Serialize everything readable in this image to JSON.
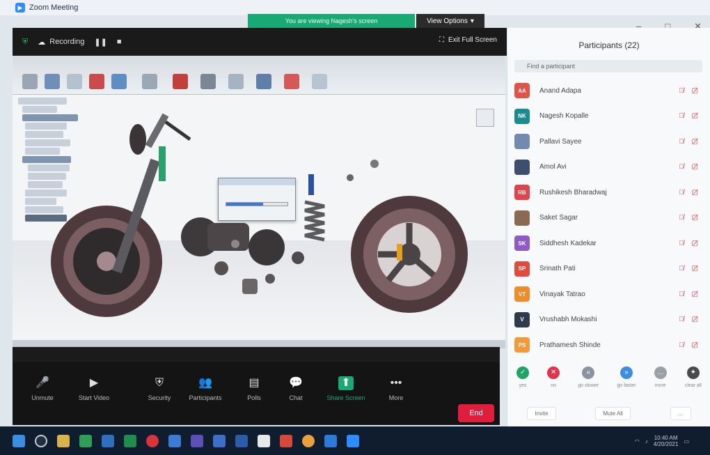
{
  "window": {
    "title": "Zoom Meeting"
  },
  "banner": {
    "text": "You are viewing Nagesh's screen",
    "view_options": "View Options"
  },
  "meeting_bar": {
    "recording": "Recording",
    "exit_full_screen": "Exit Full Screen"
  },
  "panel": {
    "title": "Participants (22)",
    "search_placeholder": "Find a participant",
    "participants": [
      {
        "initials": "AA",
        "name": "Anand Adapa",
        "color": "#e05346"
      },
      {
        "initials": "NK",
        "name": "Nagesh Kopalle",
        "color": "#1c8b8f"
      },
      {
        "initials": "",
        "name": "Pallavi Sayee",
        "color": "#7289b0"
      },
      {
        "initials": "",
        "name": "Amol Avi",
        "color": "#3c4f6d"
      },
      {
        "initials": "RB",
        "name": "Rushikesh Bharadwaj",
        "color": "#e0434a"
      },
      {
        "initials": "",
        "name": "Saket Sagar",
        "color": "#8a6a52"
      },
      {
        "initials": "SK",
        "name": "Siddhesh Kadekar",
        "color": "#8e5bc6"
      },
      {
        "initials": "SP",
        "name": "Srinath Pati",
        "color": "#e04b3e"
      },
      {
        "initials": "VT",
        "name": "Vinayak Tatrao",
        "color": "#ef8c2a"
      },
      {
        "initials": "V",
        "name": "Vrushabh Mokashi",
        "color": "#2f3a4c"
      },
      {
        "initials": "PS",
        "name": "Prathamesh Shinde",
        "color": "#f29a3a"
      }
    ],
    "reactions": [
      {
        "label": "yes",
        "color": "#1fa463",
        "glyph": "✓"
      },
      {
        "label": "no",
        "color": "#e2334a",
        "glyph": "✕"
      },
      {
        "label": "go slower",
        "color": "#8a94a0",
        "glyph": "«"
      },
      {
        "label": "go faster",
        "color": "#3a8ee0",
        "glyph": "»"
      },
      {
        "label": "more",
        "color": "#9aa0a8",
        "glyph": "…"
      },
      {
        "label": "clear all",
        "color": "#4a4a4a",
        "glyph": "✦"
      }
    ],
    "buttons": {
      "invite": "Invite",
      "mute_all": "Mute All",
      "more": "…"
    }
  },
  "controls": [
    {
      "label": "Unmute",
      "glyph": "🎤"
    },
    {
      "label": "Start Video",
      "glyph": "▶"
    },
    {
      "label": "Security",
      "glyph": "⛨"
    },
    {
      "label": "Participants",
      "glyph": "👥"
    },
    {
      "label": "Polls",
      "glyph": "▤"
    },
    {
      "label": "Chat",
      "glyph": "💬"
    },
    {
      "label": "Share Screen",
      "glyph": "⬆"
    },
    {
      "label": "More",
      "glyph": "•••"
    }
  ],
  "end_button": "End",
  "taskbar": {
    "time": "10:40 AM",
    "date": "4/20/2021"
  }
}
